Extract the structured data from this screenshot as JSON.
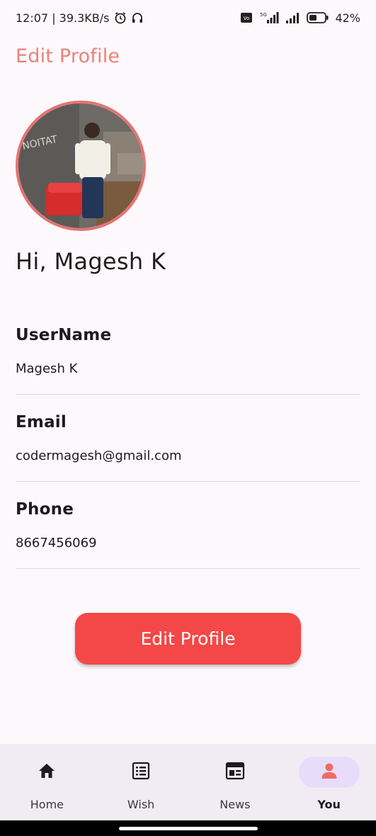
{
  "status_bar": {
    "time_speed": "12:07 | 39.3KB/s",
    "battery": "42%",
    "network": "5G"
  },
  "header": {
    "title": "Edit Profile"
  },
  "greeting": "Hi, Magesh K",
  "fields": [
    {
      "label": "UserName",
      "value": "Magesh K"
    },
    {
      "label": "Email",
      "value": "codermagesh@gmail.com"
    },
    {
      "label": "Phone",
      "value": "8667456069"
    }
  ],
  "edit_button": {
    "label": "Edit Profile"
  },
  "nav": {
    "items": [
      {
        "label": "Home",
        "icon": "home-icon"
      },
      {
        "label": "Wish",
        "icon": "list-icon"
      },
      {
        "label": "News",
        "icon": "newspaper-icon"
      },
      {
        "label": "You",
        "icon": "person-icon",
        "active": true
      }
    ]
  },
  "colors": {
    "accent": "#f44747",
    "title": "#ea8279",
    "avatar_border": "#e57373",
    "nav_active_bg": "#e7ddfa"
  }
}
